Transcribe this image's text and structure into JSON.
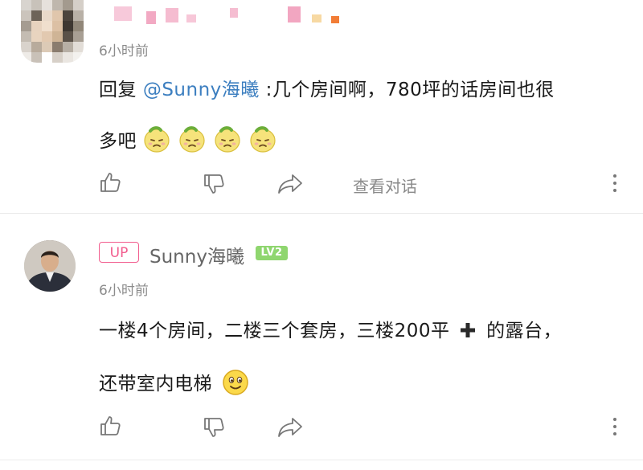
{
  "comments": [
    {
      "time": "6小时前",
      "reply_prefix": "回复 ",
      "mention": "@Sunny海曦",
      "line1_rest": " :几个房间啊，780坪的话房间也很",
      "line2": "多吧",
      "emoji_icons": [
        "sour-lemon-emoji-icon",
        "sour-lemon-emoji-icon",
        "sour-lemon-emoji-icon",
        "sour-lemon-emoji-icon"
      ],
      "dialog_link": "查看对话"
    },
    {
      "badge": "UP",
      "username": "Sunny海曦",
      "level": "LV2",
      "time": "6小时前",
      "line1_a": "一楼4个房间，二楼三个套房，三楼200平",
      "line1_b": "的露台，",
      "line2": "还带室内电梯",
      "inline_icons": [
        "heavy-plus-icon",
        "smiling-face-icon"
      ]
    }
  ],
  "colors": {
    "mention": "#3d7fc0",
    "up_badge": "#f25d8e",
    "level_badge": "#8fd66f",
    "muted_text": "#8c8c8c"
  }
}
